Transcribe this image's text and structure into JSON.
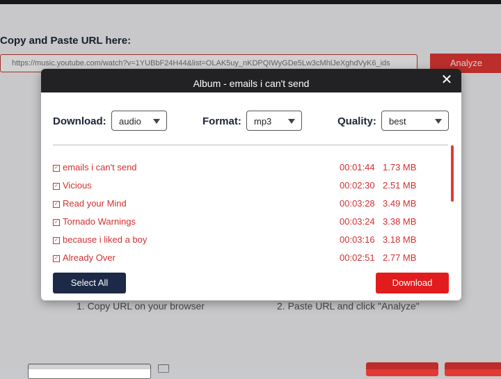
{
  "background": {
    "url_label": "Copy and Paste URL here:",
    "url_value": "https://music.youtube.com/watch?v=1YUBbF24H44&list=OLAK5uy_nKDPQIWyGDe5Lw3cMhlJeXghdVyK6_ids",
    "analyze_label": "Analyze",
    "step1": "1. Copy URL on your browser",
    "step2": "2. Paste URL and click \"Analyze\""
  },
  "modal": {
    "title": "Album - emails i can't send",
    "close_glyph": "✕",
    "download_label": "Download:",
    "download_value": "audio",
    "format_label": "Format:",
    "format_value": "mp3",
    "quality_label": "Quality:",
    "quality_value": "best",
    "tracks": [
      {
        "name": "emails i can't send",
        "duration": "00:01:44",
        "size": "1.73 MB"
      },
      {
        "name": "Vicious",
        "duration": "00:02:30",
        "size": "2.51 MB"
      },
      {
        "name": "Read your Mind",
        "duration": "00:03:28",
        "size": "3.49 MB"
      },
      {
        "name": "Tornado Warnings",
        "duration": "00:03:24",
        "size": "3.38 MB"
      },
      {
        "name": "because i liked a boy",
        "duration": "00:03:16",
        "size": "3.18 MB"
      },
      {
        "name": "Already Over",
        "duration": "00:02:51",
        "size": "2.77 MB"
      }
    ],
    "select_all_label": "Select All",
    "download_button_label": "Download"
  },
  "colors": {
    "accent": "#e21c1c",
    "dark": "#1c2a48",
    "header": "#222224",
    "track_text": "#d32f2f"
  }
}
